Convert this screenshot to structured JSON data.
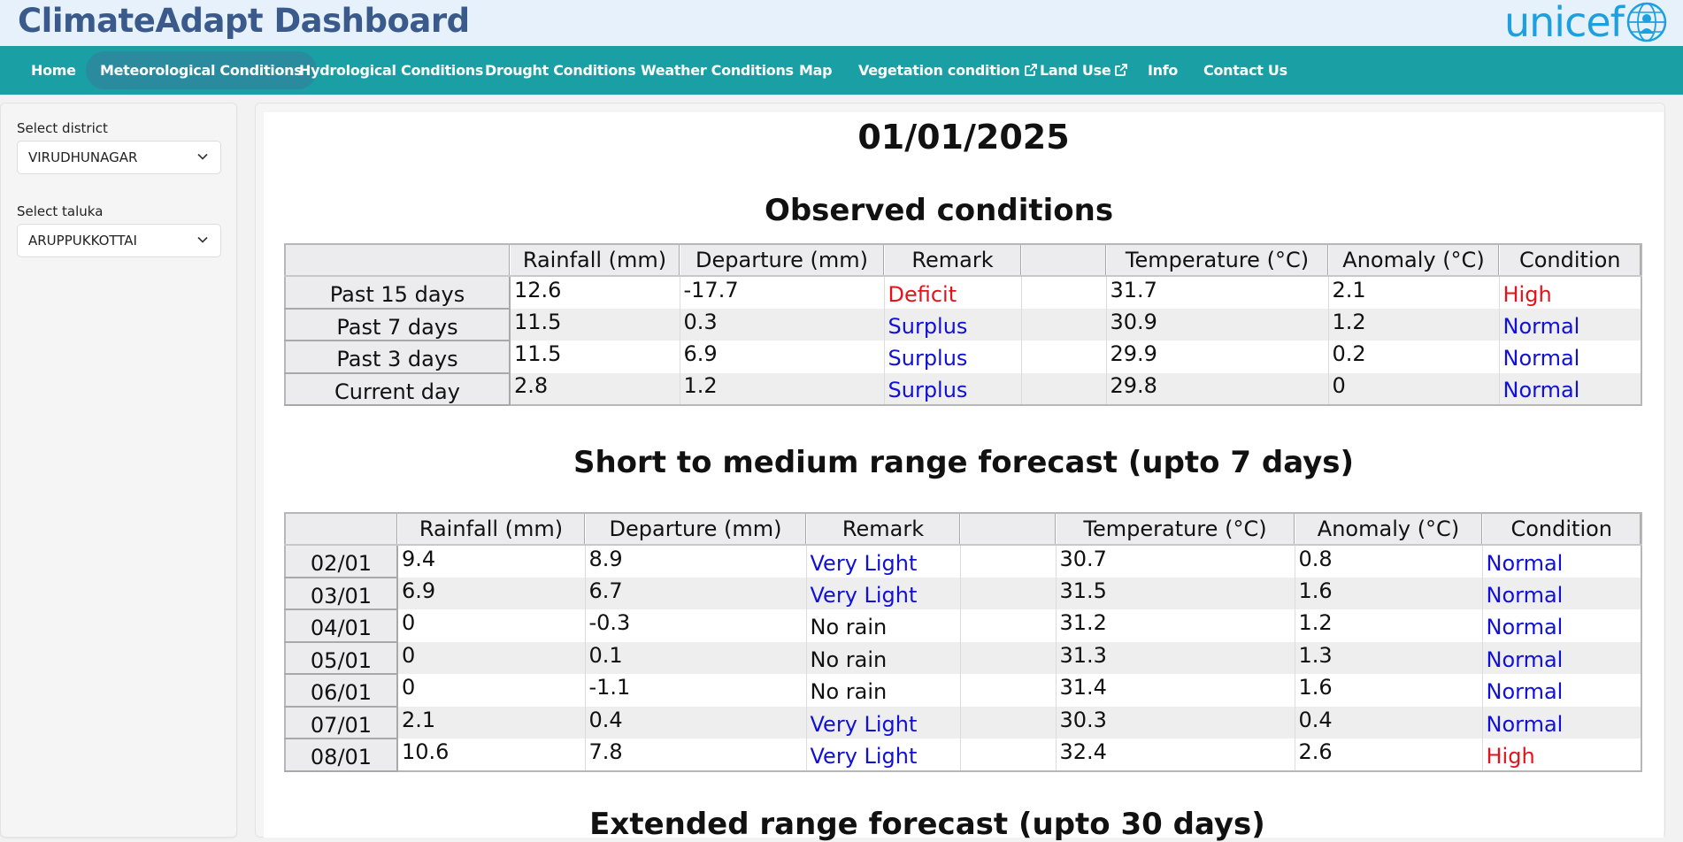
{
  "app": {
    "title": "ClimateAdapt Dashboard",
    "logo_text": "unicef",
    "brand_colors": {
      "header_bg": "#e6f1fb",
      "nav_bg": "#1a9fa4",
      "nav_active": "#2a8a9e",
      "title": "#3a5a8c",
      "unicef": "#1ca0e0"
    }
  },
  "nav": {
    "items": [
      {
        "label": "Home",
        "active": false,
        "external": false
      },
      {
        "label": "Meteorological Conditions",
        "active": true,
        "external": false
      },
      {
        "label": "Hydrological Conditions",
        "active": false,
        "external": false
      },
      {
        "label": "Drought Conditions",
        "active": false,
        "external": false
      },
      {
        "label": "Weather Conditions",
        "active": false,
        "external": false
      },
      {
        "label": "Map",
        "active": false,
        "external": false
      },
      {
        "label": "Vegetation condition",
        "active": false,
        "external": true
      },
      {
        "label": "Land Use",
        "active": false,
        "external": true
      },
      {
        "label": "Info",
        "active": false,
        "external": false
      },
      {
        "label": "Contact Us",
        "active": false,
        "external": false
      }
    ]
  },
  "sidebar": {
    "district_label": "Select district",
    "district_value": "VIRUDHUNAGAR",
    "taluka_label": "Select taluka",
    "taluka_value": "ARUPPUKKOTTAI"
  },
  "main": {
    "date": "01/01/2025",
    "observed": {
      "title": "Observed conditions",
      "headers": [
        "",
        "Rainfall (mm)",
        "Departure (mm)",
        "Remark",
        "",
        "Temperature (°C)",
        "Anomaly (°C)",
        "Condition"
      ],
      "rows": [
        {
          "label": "Past 15 days",
          "rainfall": "12.6",
          "departure": "-17.7",
          "remark": "Deficit",
          "remark_color": "red",
          "temperature": "31.7",
          "anomaly": "2.1",
          "condition": "High",
          "condition_color": "red"
        },
        {
          "label": "Past 7 days",
          "rainfall": "11.5",
          "departure": "0.3",
          "remark": "Surplus",
          "remark_color": "blue",
          "temperature": "30.9",
          "anomaly": "1.2",
          "condition": "Normal",
          "condition_color": "blue"
        },
        {
          "label": "Past 3 days",
          "rainfall": "11.5",
          "departure": "6.9",
          "remark": "Surplus",
          "remark_color": "blue",
          "temperature": "29.9",
          "anomaly": "0.2",
          "condition": "Normal",
          "condition_color": "blue"
        },
        {
          "label": "Current day",
          "rainfall": "2.8",
          "departure": "1.2",
          "remark": "Surplus",
          "remark_color": "blue",
          "temperature": "29.8",
          "anomaly": "0",
          "condition": "Normal",
          "condition_color": "blue"
        }
      ]
    },
    "short_forecast": {
      "title": "Short to medium range forecast (upto 7 days)",
      "headers": [
        "",
        "Rainfall (mm)",
        "Departure (mm)",
        "Remark",
        "",
        "Temperature (°C)",
        "Anomaly (°C)",
        "Condition"
      ],
      "rows": [
        {
          "label": "02/01",
          "rainfall": "9.4",
          "departure": "8.9",
          "remark": "Very Light",
          "remark_color": "blue",
          "temperature": "30.7",
          "anomaly": "0.8",
          "condition": "Normal",
          "condition_color": "blue"
        },
        {
          "label": "03/01",
          "rainfall": "6.9",
          "departure": "6.7",
          "remark": "Very Light",
          "remark_color": "blue",
          "temperature": "31.5",
          "anomaly": "1.6",
          "condition": "Normal",
          "condition_color": "blue"
        },
        {
          "label": "04/01",
          "rainfall": "0",
          "departure": "-0.3",
          "remark": "No rain",
          "remark_color": "black",
          "temperature": "31.2",
          "anomaly": "1.2",
          "condition": "Normal",
          "condition_color": "blue"
        },
        {
          "label": "05/01",
          "rainfall": "0",
          "departure": "0.1",
          "remark": "No rain",
          "remark_color": "black",
          "temperature": "31.3",
          "anomaly": "1.3",
          "condition": "Normal",
          "condition_color": "blue"
        },
        {
          "label": "06/01",
          "rainfall": "0",
          "departure": "-1.1",
          "remark": "No rain",
          "remark_color": "black",
          "temperature": "31.4",
          "anomaly": "1.6",
          "condition": "Normal",
          "condition_color": "blue"
        },
        {
          "label": "07/01",
          "rainfall": "2.1",
          "departure": "0.4",
          "remark": "Very Light",
          "remark_color": "blue",
          "temperature": "30.3",
          "anomaly": "0.4",
          "condition": "Normal",
          "condition_color": "blue"
        },
        {
          "label": "08/01",
          "rainfall": "10.6",
          "departure": "7.8",
          "remark": "Very Light",
          "remark_color": "blue",
          "temperature": "32.4",
          "anomaly": "2.6",
          "condition": "High",
          "condition_color": "red"
        }
      ]
    },
    "extended_forecast": {
      "title": "Extended range forecast (upto 30 days)"
    }
  }
}
